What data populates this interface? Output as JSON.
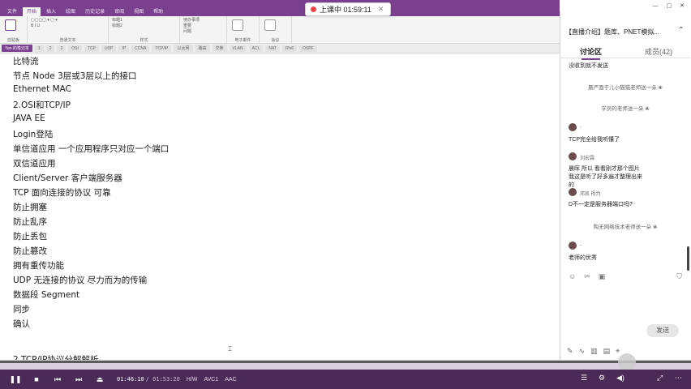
{
  "ribbon": {
    "tabs": [
      "文件",
      "开始",
      "插入",
      "绘图",
      "历史记录",
      "审阅",
      "视图",
      "帮助"
    ],
    "groups": [
      {
        "label": "剪贴板",
        "items": [
          "粘贴"
        ]
      },
      {
        "label": "普通文本",
        "items": [
          "B I U",
          "A"
        ]
      },
      {
        "label": "样式",
        "items": [
          "标题1",
          "标题2"
        ]
      },
      {
        "label": "标记",
        "items": [
          "待办事项",
          "重要",
          "问题"
        ]
      },
      {
        "label": "电子邮件",
        "items": [
          "待办事项标记"
        ]
      },
      {
        "label": "会议",
        "items": [
          "会议详细信息"
        ]
      }
    ]
  },
  "timer": {
    "label": "上课中 01:59:11"
  },
  "pagestrip": {
    "first": "Yan 的笔记本",
    "chips": [
      "1",
      "2",
      "3",
      "OSI",
      "TCP",
      "UDP",
      "IP",
      "CCNA",
      "TCP/IP",
      "以太网",
      "路由",
      "交换",
      "VLAN",
      "ACL",
      "NAT",
      "IPv6",
      "OSPF"
    ]
  },
  "notes": {
    "lines": [
      "比特流",
      "节点 Node 3层或3层以上的接口",
      "Ethernet MAC",
      "2.OSI和TCP/IP",
      "JAVA EE",
      "Login登陆",
      "单信道应用 一个应用程序只对应一个端口",
      "双信道应用",
      "Client/Server 客户端服务器",
      "TCP 面向连接的协议 可靠",
      "防止拥塞",
      "防止乱序",
      "防止丢包",
      "防止篡改",
      "拥有重传功能",
      "UDP 无连接的协议 尽力而为的传输",
      "数据段 Segment",
      "同步",
      "确认",
      "",
      "2.TCP/IP协议分解解析"
    ]
  },
  "player": {
    "play_icon": "pause-icon",
    "current_time": "01:46:10",
    "total_time": "/ 01:53:20",
    "badges": [
      "H/W",
      "AVC1",
      "AAC"
    ]
  },
  "panel": {
    "title": "【直播介绍】题库、PNET模拟...",
    "tabs": {
      "discussion": "讨论区",
      "members": "成员(42)"
    },
    "messages": [
      {
        "type": "text",
        "text": "没收到就不发送"
      },
      {
        "type": "sys",
        "text": "晨严面于儿小猫猫老师送一朵 ❀"
      },
      {
        "type": "sys",
        "text": "学员的老师送一朵 ❀"
      },
      {
        "type": "user",
        "name": "-",
        "text": "TCP完全给我听懂了"
      },
      {
        "type": "user",
        "name": "刘宏霖",
        "text": "晨晖 所以 看看刚才那个图片  我这是听了好多遍才整理出来的"
      },
      {
        "type": "user",
        "name": "邓凯  杨为",
        "text": "D不一定是服务器端口吗?"
      },
      {
        "type": "sys",
        "text": "陶无网络技术老师送一朵 ❀"
      },
      {
        "type": "user",
        "name": "-",
        "text": "老师的优秀"
      }
    ],
    "send_label": "发送"
  },
  "colors": {
    "accent": "#7b3f8f",
    "controls": "#4a2a57"
  }
}
